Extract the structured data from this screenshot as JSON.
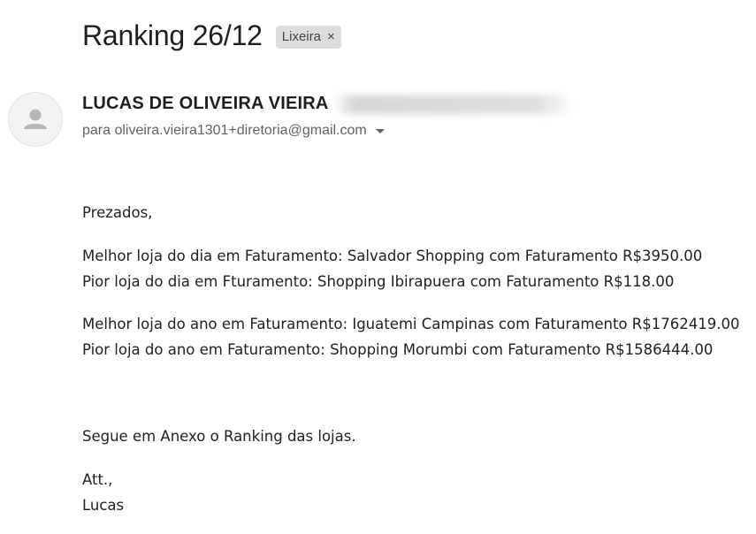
{
  "email": {
    "subject": "Ranking 26/12",
    "label": "Lixeira",
    "label_remove": "×",
    "sender_name": "LUCAS DE OLIVEIRA VIEIRA",
    "recipient": "para oliveira.vieira1301+diretoria@gmail.com",
    "body": {
      "greeting": "Prezados,",
      "best_day": "Melhor loja do dia em Faturamento: Salvador Shopping com Faturamento R$3950.00",
      "worst_day": "Pior loja do dia em Fturamento: Shopping Ibirapuera com Faturamento R$118.00",
      "best_year": "Melhor loja do ano em Faturamento: Iguatemi Campinas com Faturamento R$1762419.00",
      "worst_year": "Pior loja do ano em Faturamento: Shopping Morumbi com Faturamento R$1586444.00",
      "attachment_note": "Segue em Anexo o Ranking das lojas.",
      "closing": "Att.,",
      "signature": "Lucas"
    }
  },
  "icons": {
    "avatar": "person-icon",
    "recipient_toggle": "caret-down-icon",
    "label_remove": "close-icon"
  },
  "colors": {
    "label_chip": "#dddddd",
    "avatar_bg": "#f1f3f4",
    "avatar_glyph": "#b7b7b7",
    "muted_text": "#5f6368"
  }
}
